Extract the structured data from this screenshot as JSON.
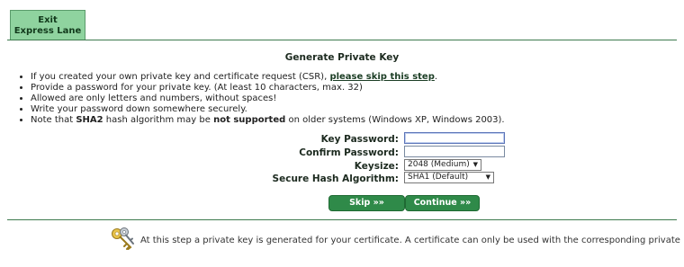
{
  "tab": {
    "line1": "Exit",
    "line2": "Express Lane"
  },
  "heading": "Generate Private Key",
  "notes": {
    "n1_pre": "If you created your own private key and certificate request (CSR), ",
    "n1_link": "please skip this step",
    "n1_post": ".",
    "n2": "Provide a password for your private key. (At least 10 characters, max. 32)",
    "n3": "Allowed are only letters and numbers, without spaces!",
    "n4": "Write your password down somewhere securely.",
    "n5_a": "Note that ",
    "n5_b": "SHA2",
    "n5_c": " hash algorithm may be ",
    "n5_d": "not supported",
    "n5_e": " on older systems (Windows XP, Windows 2003)."
  },
  "form": {
    "key_password_label": "Key Password:",
    "key_password_value": "",
    "confirm_password_label": "Confirm Password:",
    "confirm_password_value": "",
    "keysize_label": "Keysize:",
    "keysize_value": "2048 (Medium)",
    "hash_label": "Secure Hash Algorithm:",
    "hash_value": "SHA1 (Default)"
  },
  "buttons": {
    "skip": "Skip »»",
    "continue": "Continue »»"
  },
  "footer": "At this step a private key is generated for your certificate. A certificate can only be used with the corresponding private key.",
  "colors": {
    "accent": "#2f8a49",
    "tab": "#8fd39f",
    "line": "#3e7a4e"
  }
}
